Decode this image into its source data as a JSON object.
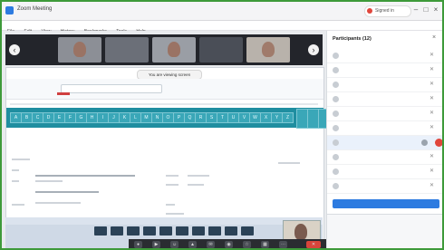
{
  "window": {
    "title": "Zoom Meeting",
    "user_name": "Signed in",
    "minimize": "–",
    "maximize": "□",
    "close": "×"
  },
  "menu": [
    "File",
    "Edit",
    "View",
    "History",
    "Bookmarks",
    "Tools",
    "Help"
  ],
  "video_strip": {
    "prev_arrow": "‹",
    "next_arrow": "›",
    "participants": [
      {
        "name": "",
        "bg": "#8c8f96"
      },
      {
        "name": "",
        "bg": "#6b6f78"
      },
      {
        "name": "",
        "bg": "#9a9ea5"
      },
      {
        "name": "",
        "bg": "#4a4e57"
      },
      {
        "name": "",
        "bg": "#b8b2ab"
      }
    ]
  },
  "shared_screen": {
    "banner": "You are viewing screen",
    "logo": "",
    "search_placeholder": "",
    "sub": "",
    "alphabet": [
      "A",
      "B",
      "C",
      "D",
      "E",
      "F",
      "G",
      "H",
      "I",
      "J",
      "K",
      "L",
      "M",
      "N",
      "O",
      "P",
      "Q",
      "R",
      "S",
      "T",
      "U",
      "V",
      "W",
      "X",
      "Y",
      "Z"
    ],
    "detail": {
      "heading": "",
      "line1": "",
      "line2": "",
      "label_a": "",
      "value_a": "",
      "label_b": "",
      "value_b": ""
    }
  },
  "participants_panel": {
    "title": "Participants (12)",
    "close": "×",
    "rows": [
      {
        "name": "",
        "muted": true
      },
      {
        "name": "",
        "muted": true
      },
      {
        "name": "",
        "muted": true
      },
      {
        "name": "",
        "muted": true
      },
      {
        "name": "",
        "muted": true
      },
      {
        "name": "",
        "muted": true
      },
      {
        "name": "",
        "muted": false,
        "selected": true
      },
      {
        "name": "",
        "muted": true
      },
      {
        "name": "",
        "muted": true
      },
      {
        "name": "",
        "muted": true
      }
    ],
    "chat_title": "",
    "chat_line1": "",
    "chat_line2": ""
  },
  "toolbar": {
    "icons": [
      "mic-icon",
      "video-icon",
      "participants-icon",
      "share-icon",
      "chat-icon",
      "record-icon",
      "reactions-icon",
      "apps-icon",
      "more-icon",
      "leave-icon"
    ]
  }
}
